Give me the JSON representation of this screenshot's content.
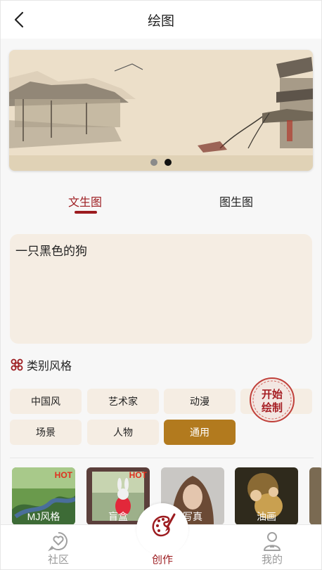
{
  "header": {
    "title": "绘图"
  },
  "banner": {
    "active_slide": 2,
    "slide_count": 2
  },
  "tabs": [
    {
      "label": "文生图",
      "active": true
    },
    {
      "label": "图生图",
      "active": false
    }
  ],
  "prompt": {
    "value": "一只黑色的狗"
  },
  "styles_section": {
    "title": "类别风格"
  },
  "styles": [
    {
      "label": "中国风",
      "selected": false
    },
    {
      "label": "艺术家",
      "selected": false
    },
    {
      "label": "动漫",
      "selected": false
    },
    {
      "label": "场景",
      "selected": false
    },
    {
      "label": "人物",
      "selected": false
    },
    {
      "label": "通用",
      "selected": true
    }
  ],
  "draw_button": {
    "label": "开始绘制"
  },
  "thumbnails": [
    {
      "label": "MJ风格",
      "badge": "HOT"
    },
    {
      "label": "盲盒",
      "badge": "HOT"
    },
    {
      "label": "写真",
      "badge": ""
    },
    {
      "label": "油画",
      "badge": ""
    }
  ],
  "tabbar": [
    {
      "label": "社区",
      "active": false
    },
    {
      "label": "创作",
      "active": true
    },
    {
      "label": "我的",
      "active": false
    }
  ],
  "colors": {
    "accent": "#9c1b1f",
    "selected_chip": "#b27a1e",
    "chip_bg": "#f5ede3"
  }
}
